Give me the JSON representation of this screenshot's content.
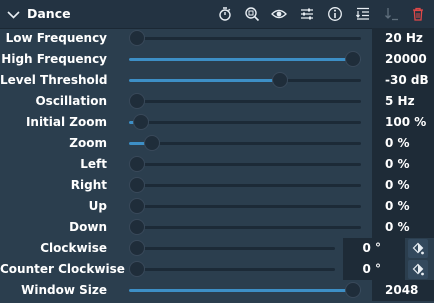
{
  "panel": {
    "title": "Dance",
    "toolbar": [
      {
        "name": "stopwatch-icon"
      },
      {
        "name": "zoom-fit-icon"
      },
      {
        "name": "eye-icon"
      },
      {
        "name": "adjust-icon"
      },
      {
        "name": "info-icon"
      },
      {
        "name": "collapse-all-icon"
      },
      {
        "name": "move-down-icon"
      },
      {
        "name": "delete-icon"
      }
    ]
  },
  "params": [
    {
      "label": "Low Frequency",
      "value": "20 Hz",
      "level": 0.0
    },
    {
      "label": "High Frequency",
      "value": "20000 Hz",
      "level": 1.0
    },
    {
      "label": "Level Threshold",
      "value": "-30 dB",
      "level": 0.65
    },
    {
      "label": "Oscillation",
      "value": "5 Hz",
      "level": 0.0
    },
    {
      "label": "Initial Zoom",
      "value": "100 %",
      "level": 0.05
    },
    {
      "label": "Zoom",
      "value": "0 %",
      "level": 0.1
    },
    {
      "label": "Left",
      "value": "0 %",
      "level": 0.0
    },
    {
      "label": "Right",
      "value": "0 %",
      "level": 0.0
    },
    {
      "label": "Up",
      "value": "0 %",
      "level": 0.0
    },
    {
      "label": "Down",
      "value": "0 %",
      "level": 0.0
    },
    {
      "label": "Clockwise",
      "value": "0 °",
      "level": 0.0
    },
    {
      "label": "Counter Clockwise",
      "value": "0 °",
      "level": 0.0
    },
    {
      "label": "Window Size",
      "value": "2048",
      "level": 1.0
    }
  ],
  "colors": {
    "background": "#2b3e4e",
    "header": "#233342",
    "accent": "#3d8fc6",
    "delete": "#e04848",
    "disabled": "#5f6f7d"
  }
}
